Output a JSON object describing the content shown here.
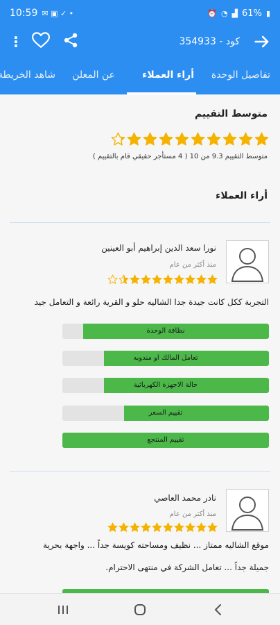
{
  "status_bar": {
    "time": "10:59",
    "battery": "61%"
  },
  "app_bar": {
    "code_label": "كود - ",
    "code_number": "354933",
    "icons": [
      "menu-dots-icon",
      "heart-icon",
      "share-icon",
      "arrow-right-icon"
    ]
  },
  "tabs": [
    {
      "label": "تفاصيل الوحدة",
      "active": false
    },
    {
      "label": "أراء العملاء",
      "active": true
    },
    {
      "label": "عن المعلن",
      "active": false
    },
    {
      "label": "شاهد الخريطة",
      "active": false
    }
  ],
  "rating": {
    "title": "متوسط التقييم",
    "stars_filled": 9.3,
    "stars_total": 10,
    "caption": "متوسط التقييم 9.3 من 10 ( 4 مستأجر حقيقي قام بالتقييم )"
  },
  "reviews_title": "أراء العملاء",
  "reviews": [
    {
      "name": "نورا سعد الدين إبراهيم أبو العينين",
      "date": "منذ أكثر من عام",
      "stars": 8.5,
      "text": "التجربة ككل كانت جيدة جدا الشاليه حلو و القرية رائعة و التعامل جيد",
      "bars": [
        {
          "label": "نظافة الوحدة",
          "value": 0.9
        },
        {
          "label": "تعامل المالك او مندوبه",
          "value": 0.8
        },
        {
          "label": "حالة الاجهزة الكهربائية",
          "value": 0.8
        },
        {
          "label": "تقييم السعر",
          "value": 0.7
        },
        {
          "label": "تقييم المنتجع",
          "value": 1.0
        }
      ]
    },
    {
      "name": "نادر محمد العاصي",
      "date": "منذ أكثر من عام",
      "stars": 10,
      "text_line1": "موقع الشاليه ممتاز ... نظيف ومساحته كويسة جداً ... واجهة بحرية",
      "text_line2": "جميلة جداً ... تعامل الشركة في منتهى الاحترام."
    }
  ],
  "colors": {
    "primary": "#2b8ef0",
    "star": "#f5b301",
    "bar_fill": "#4cb84a",
    "bar_bg": "#e3e3e3"
  }
}
